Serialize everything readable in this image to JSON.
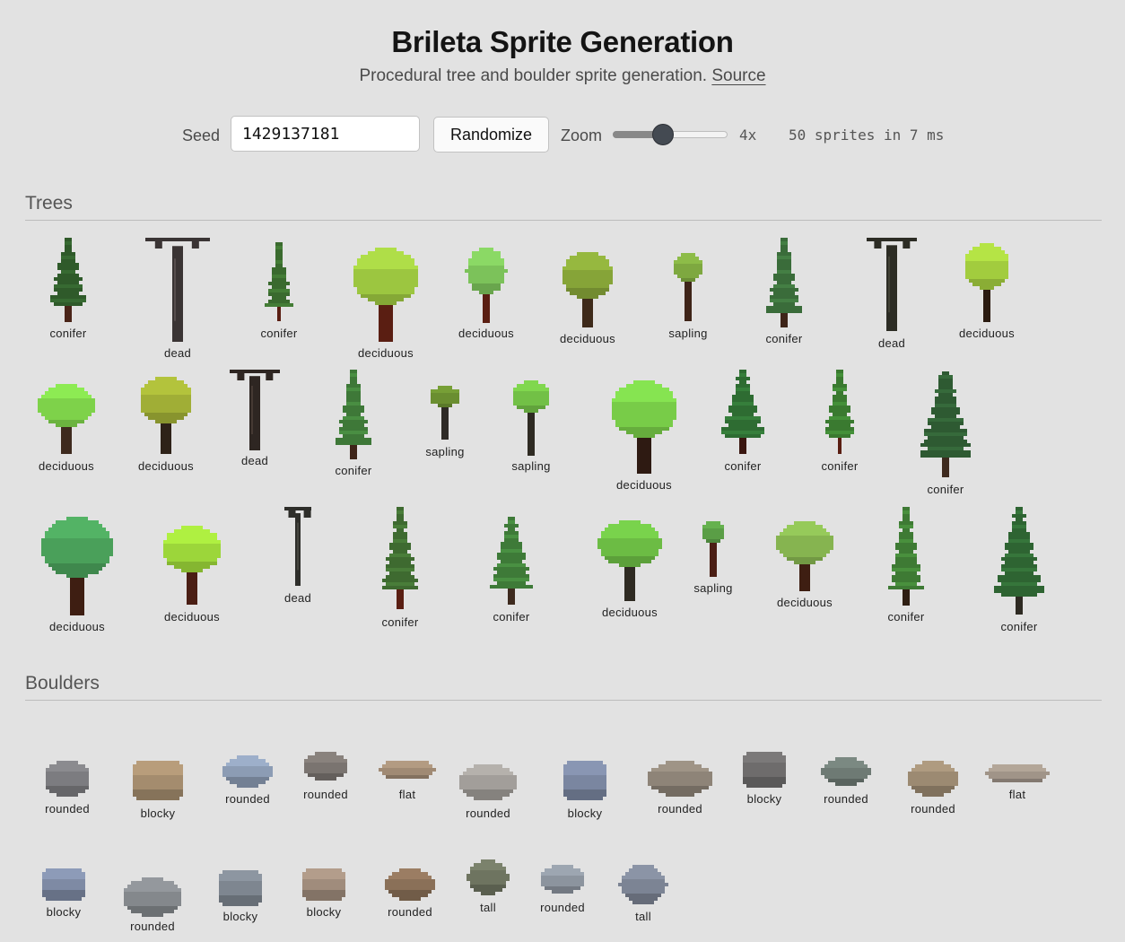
{
  "header": {
    "title": "Brileta Sprite Generation",
    "subtitle": "Procedural tree and boulder sprite generation.",
    "source_link": "Source"
  },
  "controls": {
    "seed_label": "Seed",
    "seed_value": "1429137181",
    "randomize_label": "Randomize",
    "zoom_label": "Zoom",
    "zoom_value": "4x",
    "zoom_fraction": 0.44,
    "stats": "50 sprites in 7 ms"
  },
  "trees": {
    "heading": "Trees",
    "items": [
      {
        "label": "conifer",
        "color": "#2f5a2a",
        "trunk": "#4a2418"
      },
      {
        "label": "dead",
        "color": "#3a3434",
        "trunk": "#3a3434"
      },
      {
        "label": "conifer",
        "color": "#3a6a2e",
        "trunk": "#5a1e12"
      },
      {
        "label": "deciduous",
        "color": "#9cc640",
        "trunk": "#5a1e12"
      },
      {
        "label": "deciduous",
        "color": "#7cc25a",
        "trunk": "#5a1e12"
      },
      {
        "label": "deciduous",
        "color": "#86a438",
        "trunk": "#3e2a1a"
      },
      {
        "label": "sapling",
        "color": "#7ea840",
        "trunk": "#3e2418"
      },
      {
        "label": "conifer",
        "color": "#3a6c3a",
        "trunk": "#3e2418"
      },
      {
        "label": "dead",
        "color": "#2c2c24",
        "trunk": "#2c2c24"
      },
      {
        "label": "deciduous",
        "color": "#a2cc3e",
        "trunk": "#2a1a10"
      },
      {
        "label": "deciduous",
        "color": "#7ed24a",
        "trunk": "#3e2a1e"
      },
      {
        "label": "deciduous",
        "color": "#a0ae36",
        "trunk": "#2e2218"
      },
      {
        "label": "dead",
        "color": "#2e2622",
        "trunk": "#2e2622"
      },
      {
        "label": "conifer",
        "color": "#3e7838",
        "trunk": "#3e2418"
      },
      {
        "label": "sapling",
        "color": "#6a8e30",
        "trunk": "#2e2a26"
      },
      {
        "label": "sapling",
        "color": "#72c046",
        "trunk": "#2e2a22"
      },
      {
        "label": "deciduous",
        "color": "#78cc48",
        "trunk": "#2e1a12"
      },
      {
        "label": "conifer",
        "color": "#2e6c32",
        "trunk": "#3a1610"
      },
      {
        "label": "conifer",
        "color": "#3a7a30",
        "trunk": "#5a1e12"
      },
      {
        "label": "conifer",
        "color": "#2e5a32",
        "trunk": "#3e2a1e"
      },
      {
        "label": "deciduous",
        "color": "#4aa05a",
        "trunk": "#3e1e12"
      },
      {
        "label": "deciduous",
        "color": "#9cd63a",
        "trunk": "#4a1e14"
      },
      {
        "label": "dead",
        "color": "#2e2e2a",
        "trunk": "#2e2e2a"
      },
      {
        "label": "conifer",
        "color": "#3e6a30",
        "trunk": "#5a1e12"
      },
      {
        "label": "conifer",
        "color": "#3e7a38",
        "trunk": "#3e2a1e"
      },
      {
        "label": "deciduous",
        "color": "#6cbc44",
        "trunk": "#2e2a22"
      },
      {
        "label": "sapling",
        "color": "#5a9e46",
        "trunk": "#4a1e14"
      },
      {
        "label": "deciduous",
        "color": "#86b450",
        "trunk": "#3e1e12"
      },
      {
        "label": "conifer",
        "color": "#3e7a34",
        "trunk": "#2e1e12"
      },
      {
        "label": "conifer",
        "color": "#2e6432",
        "trunk": "#2e2a22"
      }
    ]
  },
  "boulders": {
    "heading": "Boulders",
    "items": [
      {
        "label": "rounded",
        "color": "#7c7c80"
      },
      {
        "label": "blocky",
        "color": "#a48c6e"
      },
      {
        "label": "rounded",
        "color": "#8c9cb4"
      },
      {
        "label": "rounded",
        "color": "#7a7470"
      },
      {
        "label": "flat",
        "color": "#a08a74"
      },
      {
        "label": "rounded",
        "color": "#a29e9a"
      },
      {
        "label": "blocky",
        "color": "#7a86a0"
      },
      {
        "label": "rounded",
        "color": "#8e8478"
      },
      {
        "label": "blocky",
        "color": "#6e6c6c"
      },
      {
        "label": "rounded",
        "color": "#6e7a74"
      },
      {
        "label": "rounded",
        "color": "#9c8a72"
      },
      {
        "label": "flat",
        "color": "#a09488"
      },
      {
        "label": "blocky",
        "color": "#7e8aa4"
      },
      {
        "label": "rounded",
        "color": "#84888c"
      },
      {
        "label": "blocky",
        "color": "#7e8690"
      },
      {
        "label": "blocky",
        "color": "#a08c7c"
      },
      {
        "label": "rounded",
        "color": "#8a7058"
      },
      {
        "label": "tall",
        "color": "#6e7460"
      },
      {
        "label": "rounded",
        "color": "#8c949e"
      },
      {
        "label": "tall",
        "color": "#7c8494"
      }
    ]
  }
}
